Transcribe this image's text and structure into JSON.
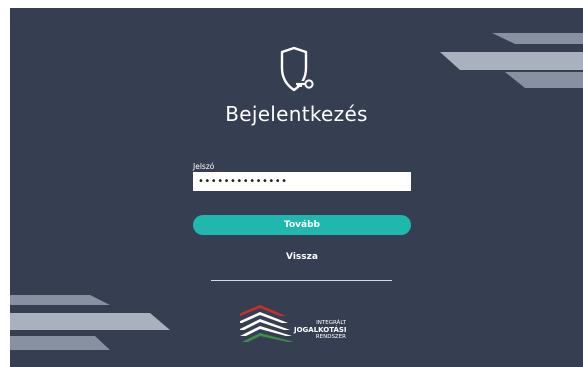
{
  "login": {
    "title": "Bejelentkezés",
    "password_label": "Jelszó",
    "password_value": "••••••••••••••",
    "next_label": "Tovább",
    "back_label": "Vissza"
  },
  "brand": {
    "line1": "INTEGRÁLT",
    "line2": "JOGALKOTÁSI",
    "line3": "RENDSZER"
  },
  "colors": {
    "background": "#363e52",
    "accent": "#1fb7ae",
    "text": "#ffffff",
    "logo_red": "#c9302c",
    "logo_green": "#3a8f4a"
  },
  "icons": {
    "login_icon": "shield-key-icon"
  }
}
